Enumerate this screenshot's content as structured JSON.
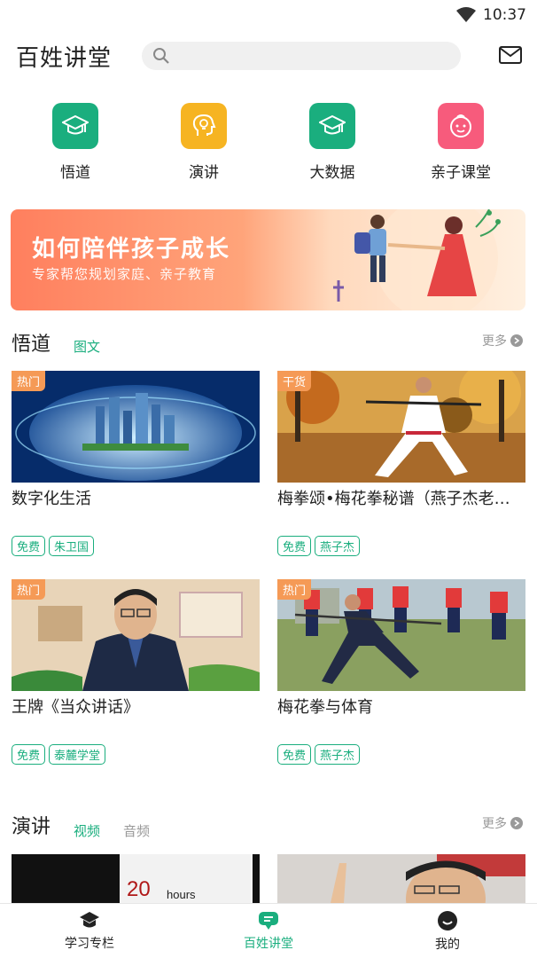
{
  "status": {
    "time": "10:37"
  },
  "header": {
    "title": "百姓讲堂",
    "search_placeholder": ""
  },
  "categories": [
    {
      "label": "悟道",
      "icon": "graduation-cap-icon",
      "color": "#1aae7e"
    },
    {
      "label": "演讲",
      "icon": "head-lightbulb-icon",
      "color": "#f6b422"
    },
    {
      "label": "大数据",
      "icon": "graduation-cap-icon",
      "color": "#1aae7e"
    },
    {
      "label": "亲子课堂",
      "icon": "baby-face-icon",
      "color": "#f75b7c"
    }
  ],
  "banner": {
    "title": "如何陪伴孩子成长",
    "subtitle": "专家帮您规划家庭、亲子教育"
  },
  "section1": {
    "title": "悟道",
    "tab": "图文",
    "more": "更多",
    "cards": [
      {
        "badge": "热门",
        "title": "数字化生活",
        "tags": [
          "免费",
          "朱卫国"
        ]
      },
      {
        "badge": "干货",
        "title": "梅拳颂•梅花拳秘谱（燕子杰老师）",
        "tags": [
          "免费",
          "燕子杰"
        ]
      },
      {
        "badge": "热门",
        "title": "王牌《当众讲话》",
        "tags": [
          "免费",
          "泰麓学堂"
        ]
      },
      {
        "badge": "热门",
        "title": "梅花拳与体育",
        "tags": [
          "免费",
          "燕子杰"
        ]
      }
    ]
  },
  "section2": {
    "title": "演讲",
    "tab_active": "视频",
    "tab_inactive": "音频",
    "more": "更多",
    "thumb_text": "hours",
    "thumb_number": "20"
  },
  "tabbar": [
    {
      "label": "学习专栏",
      "icon": "study-hat-icon"
    },
    {
      "label": "百姓讲堂",
      "icon": "chat-bubble-icon"
    },
    {
      "label": "我的",
      "icon": "profile-smile-icon"
    }
  ],
  "colors": {
    "accent": "#1aae7e",
    "badge": "#f59a56"
  }
}
